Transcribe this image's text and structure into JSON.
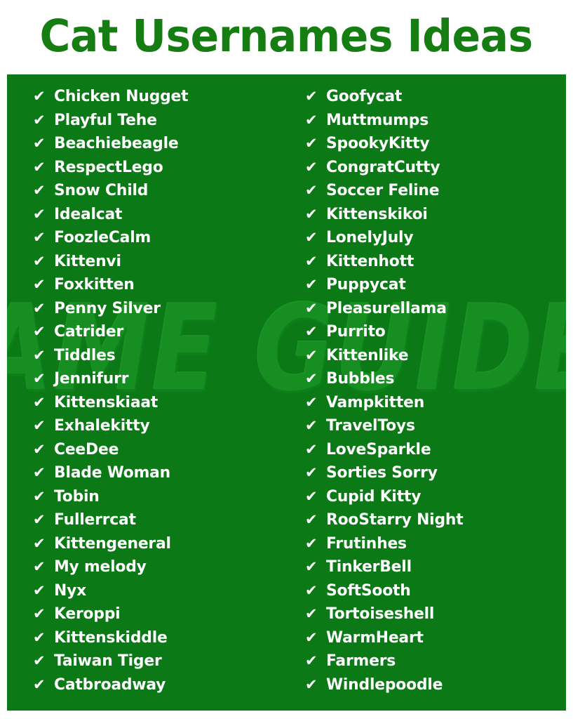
{
  "header": {
    "title": "Cat Usernames Ideas",
    "title_color": "#157D12"
  },
  "panel": {
    "background_color": "#0B7A16",
    "text_color": "#FDFDFD",
    "bullet_icon": "check-icon",
    "bullet_glyph": "✔"
  },
  "watermark": {
    "text": "NAME GUIDER",
    "color": "#178F22"
  },
  "columns": [
    {
      "name": "left-column",
      "items": [
        "Chicken Nugget",
        "Playful Tehe",
        "Beachiebeagle",
        "RespectLego",
        "Snow Child",
        "Idealcat",
        "FoozleCalm",
        "Kittenvi",
        "Foxkitten",
        "Penny Silver",
        "Catrider",
        "Tiddles",
        "Jennifurr",
        "Kittenskiaat",
        "Exhalekitty",
        "CeeDee",
        "Blade Woman",
        "Tobin",
        "Fullerrcat",
        "Kittengeneral",
        "My melody",
        "Nyx",
        "Keroppi",
        "Kittenskiddle",
        "Taiwan Tiger",
        "Catbroadway"
      ]
    },
    {
      "name": "right-column",
      "items": [
        "Goofycat",
        "Muttmumps",
        "SpookyKitty",
        "CongratCutty",
        "Soccer Feline",
        "Kittenskikoi",
        "LonelyJuly",
        "Kittenhott",
        "Puppycat",
        "Pleasurellama",
        "Purrito",
        "Kittenlike",
        "Bubbles",
        "Vampkitten",
        "TravelToys",
        "LoveSparkle",
        "Sorties Sorry",
        "Cupid Kitty",
        "RooStarry Night",
        "Frutinhes",
        "TinkerBell",
        "SoftSooth",
        "Tortoiseshell",
        "WarmHeart",
        "Farmers",
        "Windlepoodle"
      ]
    }
  ]
}
